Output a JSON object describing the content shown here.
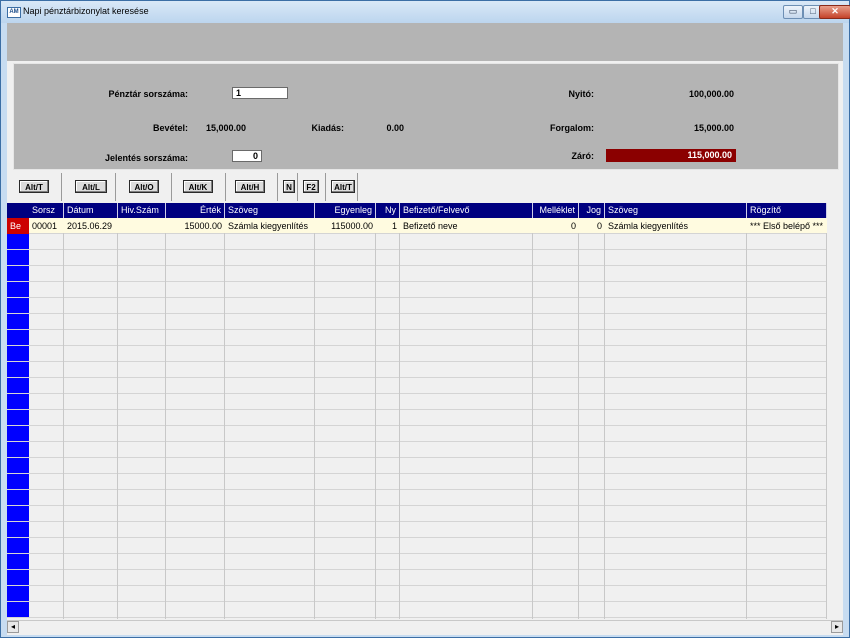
{
  "window": {
    "title": "Napi pénztárbizonylat keresése",
    "app_icon_text": "AM",
    "minimize_label": "▭",
    "maximize_label": "□",
    "close_label": "✕"
  },
  "summary": {
    "cashbox_label": "Pénztár sorszáma:",
    "cashbox_value": "1",
    "income_label": "Bevétel:",
    "income_value": "15,000.00",
    "expense_label": "Kiadás:",
    "expense_value": "0.00",
    "report_label": "Jelentés sorszáma:",
    "report_value": "0",
    "opening_label": "Nyitó:",
    "opening_value": "100,000.00",
    "turnover_label": "Forgalom:",
    "turnover_value": "15,000.00",
    "closing_label": "Záró:",
    "closing_value": "115,000.00",
    "closing_color": "#8b0000"
  },
  "toolbar": {
    "buttons": [
      "Alt/T",
      "Alt/L",
      "Alt/O",
      "Alt/K",
      "Alt/H",
      "N",
      "F2",
      "Alt/T"
    ]
  },
  "grid": {
    "headers": [
      "Sorsz",
      "Dátum",
      "Hiv.Szám",
      "Érték",
      "Szöveg",
      "Egyenleg",
      "Ny",
      "Befizető/Felvevő",
      "Melléklet",
      "Jog",
      "Szöveg",
      "Rögzítő"
    ],
    "rows": [
      [
        "00001",
        "2015.06.29",
        "",
        "15000.00",
        "Számla kiegyenlítés",
        "115000.00",
        "1",
        "Befizető neve",
        "0",
        "0",
        "Számla kiegyenlítés",
        "*** Első  belépő ***"
      ]
    ],
    "row_marker": "Be",
    "header_color": "#000080",
    "selected_row_color": "#fffbe0",
    "marker_color": "#cc0000",
    "selector_color": "#0000ff"
  },
  "scrollbar": {
    "left_arrow": "◂",
    "right_arrow": "▸"
  }
}
